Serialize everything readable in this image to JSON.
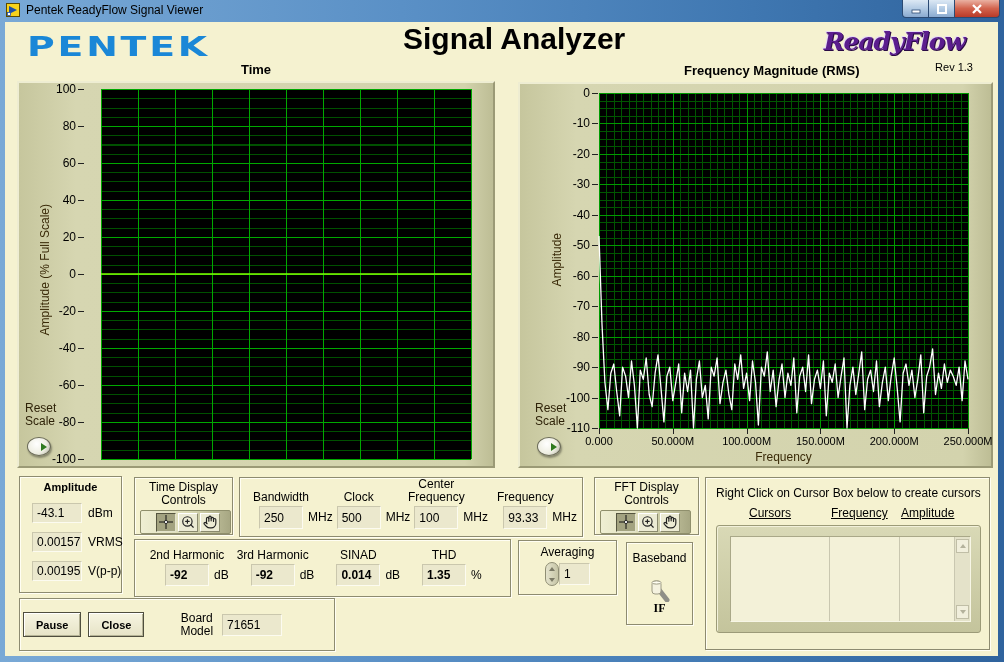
{
  "window": {
    "title": "Pentek ReadyFlow Signal Viewer"
  },
  "header": {
    "logo": "PENTEK",
    "title": "Signal Analyzer",
    "product_logo": "ReadyFlow",
    "revision": "Rev 1.3"
  },
  "time_chart": {
    "chart_data": {
      "type": "line",
      "title": "Time",
      "ylabel": "Amplitude (% Full Scale)",
      "ylim": [
        -100,
        100
      ],
      "yticks": [
        100,
        80,
        60,
        40,
        20,
        0,
        -20,
        -40,
        -60,
        -80,
        -100
      ],
      "grid": true,
      "values": [
        0,
        0,
        0,
        0,
        0,
        0,
        0,
        0,
        0,
        0,
        0
      ]
    },
    "reset_label": "Reset Scale"
  },
  "fft_chart": {
    "chart_data": {
      "type": "line",
      "title": "Frequency Magnitude (RMS)",
      "xlabel": "Frequency",
      "ylabel": "Amplitude",
      "xlim": [
        0,
        250000000
      ],
      "ylim": [
        -110,
        0
      ],
      "xticks": [
        {
          "value": 0,
          "label": "0.000"
        },
        {
          "value": 50000000,
          "label": "50.000M"
        },
        {
          "value": 100000000,
          "label": "100.000M"
        },
        {
          "value": 150000000,
          "label": "150.000M"
        },
        {
          "value": 200000000,
          "label": "200.000M"
        },
        {
          "value": 250000000,
          "label": "250.000M"
        }
      ],
      "yticks": [
        0,
        -10,
        -20,
        -30,
        -40,
        -50,
        -60,
        -70,
        -80,
        -90,
        -100,
        -110
      ],
      "grid": true,
      "x": [
        0,
        2000000,
        4000000,
        6000000,
        8000000,
        10000000,
        12000000,
        14000000,
        16000000,
        18000000,
        20000000,
        22000000,
        24000000,
        26000000,
        28000000,
        30000000,
        32000000,
        34000000,
        36000000,
        38000000,
        40000000,
        42000000,
        44000000,
        46000000,
        48000000,
        50000000,
        52000000,
        54000000,
        56000000,
        58000000,
        60000000,
        62000000,
        64000000,
        66000000,
        68000000,
        70000000,
        72000000,
        74000000,
        76000000,
        78000000,
        80000000,
        82000000,
        84000000,
        86000000,
        88000000,
        90000000,
        92000000,
        94000000,
        96000000,
        98000000,
        100000000,
        102000000,
        104000000,
        106000000,
        108000000,
        110000000,
        112000000,
        114000000,
        116000000,
        118000000,
        120000000,
        122000000,
        124000000,
        126000000,
        128000000,
        130000000,
        132000000,
        134000000,
        136000000,
        138000000,
        140000000,
        142000000,
        144000000,
        146000000,
        148000000,
        150000000,
        152000000,
        154000000,
        156000000,
        158000000,
        160000000,
        162000000,
        164000000,
        166000000,
        168000000,
        170000000,
        172000000,
        174000000,
        176000000,
        178000000,
        180000000,
        182000000,
        184000000,
        186000000,
        188000000,
        190000000,
        192000000,
        194000000,
        196000000,
        198000000,
        200000000,
        202000000,
        204000000,
        206000000,
        208000000,
        210000000,
        212000000,
        214000000,
        216000000,
        218000000,
        220000000,
        222000000,
        224000000,
        226000000,
        228000000,
        230000000,
        232000000,
        234000000,
        236000000,
        238000000,
        240000000,
        242000000,
        244000000,
        246000000,
        248000000,
        250000000
      ],
      "values": [
        -47,
        -76,
        -95,
        -104,
        -92,
        -89,
        -98,
        -106,
        -90,
        -93,
        -100,
        -88,
        -96,
        -110,
        -91,
        -94,
        -87,
        -99,
        -103,
        -92,
        -86,
        -97,
        -108,
        -93,
        -90,
        -101,
        -95,
        -89,
        -105,
        -92,
        -98,
        -91,
        -110,
        -94,
        -88,
        -100,
        -96,
        -107,
        -90,
        -93,
        -87,
        -102,
        -95,
        -91,
        -99,
        -104,
        -89,
        -94,
        -86,
        -97,
        -92,
        -101,
        -88,
        -95,
        -109,
        -90,
        -93,
        -85,
        -98,
        -91,
        -103,
        -94,
        -89,
        -100,
        -92,
        -96,
        -87,
        -105,
        -93,
        -90,
        -98,
        -86,
        -102,
        -94,
        -91,
        -97,
        -88,
        -106,
        -92,
        -95,
        -89,
        -100,
        -93,
        -87,
        -110,
        -96,
        -90,
        -99,
        -92,
        -85,
        -104,
        -94,
        -91,
        -98,
        -88,
        -103,
        -95,
        -90,
        -101,
        -93,
        -87,
        -97,
        -108,
        -92,
        -89,
        -96,
        -91,
        -100,
        -94,
        -86,
        -105,
        -93,
        -90,
        -84,
        -99,
        -92,
        -97,
        -89,
        -95,
        -91,
        -93,
        -96,
        -90,
        -101,
        -88,
        -94
      ]
    },
    "reset_label": "Reset Scale"
  },
  "amplitude": {
    "title": "Amplitude",
    "readings": [
      {
        "value": "-43.1",
        "unit": "dBm"
      },
      {
        "value": "0.00157",
        "unit": "VRMS"
      },
      {
        "value": "0.00195",
        "unit": "V(p-p)"
      }
    ]
  },
  "time_display_controls": {
    "title": "Time Display Controls",
    "tools": [
      {
        "kind": "cursor",
        "selected": true
      },
      {
        "kind": "zoom",
        "selected": false
      },
      {
        "kind": "pan",
        "selected": false
      }
    ]
  },
  "settings": [
    {
      "label": "Bandwidth",
      "value": "250",
      "unit": "MHz"
    },
    {
      "label": "Clock",
      "value": "500",
      "unit": "MHz"
    },
    {
      "label": "Center Frequency",
      "value": "100",
      "unit": "MHz"
    },
    {
      "label": "Frequency",
      "value": "93.33",
      "unit": "MHz"
    }
  ],
  "fft_display_controls": {
    "title": "FFT Display Controls",
    "tools": [
      {
        "kind": "cursor",
        "selected": true
      },
      {
        "kind": "zoom",
        "selected": false
      },
      {
        "kind": "pan",
        "selected": false
      }
    ]
  },
  "cursors": {
    "hint": "Right Click on Cursor Box below to create cursors",
    "columns": [
      "Cursors",
      "Frequency",
      "Amplitude"
    ]
  },
  "measurements": [
    {
      "label": "2nd Harmonic",
      "value": "-92",
      "unit": "dB"
    },
    {
      "label": "3rd Harmonic",
      "value": "-92",
      "unit": "dB"
    },
    {
      "label": "SINAD",
      "value": "0.014",
      "unit": "dB"
    },
    {
      "label": "THD",
      "value": "1.35",
      "unit": "%"
    }
  ],
  "averaging": {
    "label": "Averaging",
    "value": "1"
  },
  "baseband": {
    "label": "Baseband",
    "on": false,
    "state_label": "IF"
  },
  "buttons": [
    "Pause",
    "Close"
  ],
  "board_model": {
    "label": "Board Model",
    "value": "71651"
  }
}
